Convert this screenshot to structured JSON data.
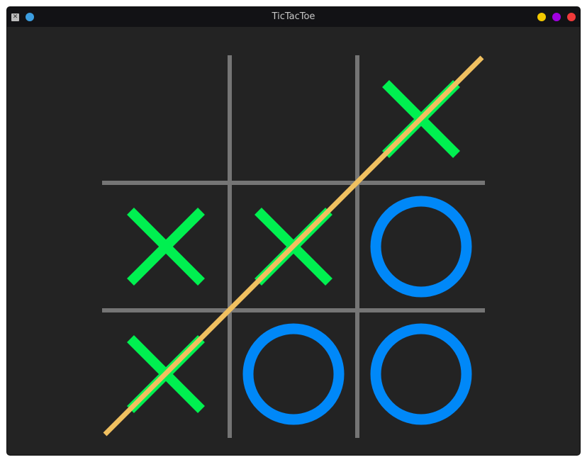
{
  "window": {
    "title": "TicTacToe",
    "app_icon": "x-window-icon",
    "menu_icon": "menu-dot-icon",
    "buttons": [
      {
        "name": "minimize",
        "color": "#f2c800"
      },
      {
        "name": "maximize",
        "color": "#a000e0"
      },
      {
        "name": "close",
        "color": "#f03a3a"
      }
    ]
  },
  "game": {
    "board": [
      [
        "",
        "",
        "X"
      ],
      [
        "X",
        "X",
        "O"
      ],
      [
        "X",
        "O",
        "O"
      ]
    ],
    "winner": "X",
    "winning_line": "anti-diagonal",
    "colors": {
      "background": "#232323",
      "grid": "#757575",
      "x": "#00f050",
      "o": "#0088f8",
      "win_line": "#f0c060"
    }
  }
}
